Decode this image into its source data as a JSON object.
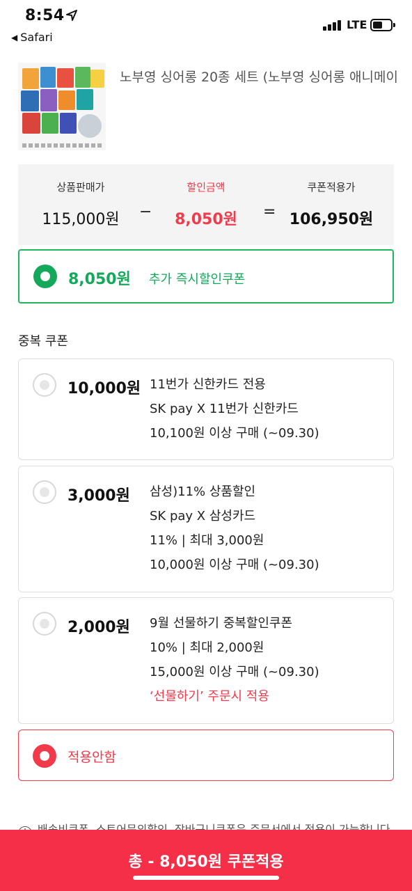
{
  "status_bar": {
    "time": "8:54",
    "back_app": "Safari",
    "network": "LTE"
  },
  "product": {
    "title": "노부영 싱어롱 20종 세트 (노부영 싱어롱 애니메이"
  },
  "summary": {
    "sale_label": "상품판매가",
    "sale_value": "115,000원",
    "minus": "−",
    "discount_label": "할인금액",
    "discount_value": "8,050원",
    "equals": "=",
    "final_label": "쿠폰적용가",
    "final_value": "106,950원"
  },
  "main_coupon": {
    "amount": "8,050원",
    "desc": "추가 즉시할인쿠폰"
  },
  "dup_title": "중복 쿠폰",
  "coupons": [
    {
      "amount": "10,000원",
      "lines": [
        "11번가 신한카드 전용",
        "SK pay X 11번가 신한카드",
        "10,100원 이상 구매 (~09.30)"
      ]
    },
    {
      "amount": "3,000원",
      "lines": [
        "삼성)11% 상품할인",
        "SK pay X 삼성카드",
        "11% | 최대 3,000원",
        "10,000원 이상 구매 (~09.30)"
      ]
    },
    {
      "amount": "2,000원",
      "lines": [
        "9월 선물하기 중복할인쿠폰",
        "10% | 최대 2,000원",
        "15,000원 이상 구매 (~09.30)"
      ],
      "note": "‘선물하기’ 주문시 적용"
    }
  ],
  "no_apply": "적용안함",
  "notice": "배송비쿠폰, 스토어문의할인, 장바구니쿠폰은 주문서에서 적용이 가능합니다",
  "bottom_button": "총 - 8,050원 쿠폰적용",
  "colors": {
    "accent_red": "#f23b4a",
    "accent_green": "#14a85a",
    "button_red": "#f42f47"
  }
}
